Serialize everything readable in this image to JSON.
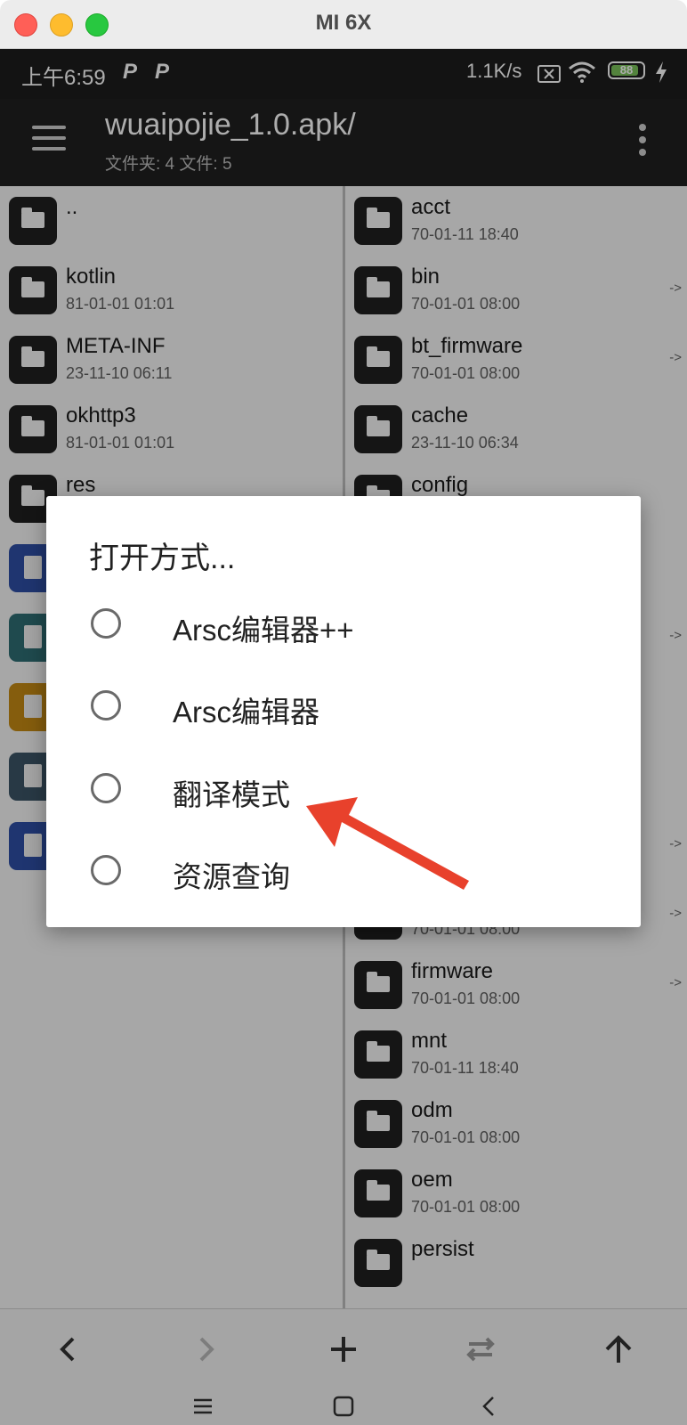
{
  "window": {
    "title": "MI 6X"
  },
  "status_bar": {
    "time": "上午6:59",
    "p_icons": [
      "P",
      "P"
    ],
    "net_speed": "1.1K/s",
    "battery": "88"
  },
  "app_bar": {
    "title": "wuaipojie_1.0.apk/",
    "subtitle": "文件夹: 4  文件: 5"
  },
  "left_pane": {
    "items": [
      {
        "name": "..",
        "date": ""
      },
      {
        "name": "kotlin",
        "date": "81-01-01 01:01"
      },
      {
        "name": "META-INF",
        "date": "23-11-10 06:11"
      },
      {
        "name": "okhttp3",
        "date": "81-01-01 01:01"
      },
      {
        "name": "res",
        "date": ""
      }
    ]
  },
  "right_pane": {
    "items": [
      {
        "name": "acct",
        "date": "70-01-11 18:40",
        "arrow": ""
      },
      {
        "name": "bin",
        "date": "70-01-01 08:00",
        "arrow": "->"
      },
      {
        "name": "bt_firmware",
        "date": "70-01-01 08:00",
        "arrow": "->"
      },
      {
        "name": "cache",
        "date": "23-11-10 06:34",
        "arrow": ""
      },
      {
        "name": "config",
        "date": "",
        "arrow": ""
      },
      {
        "name": "",
        "date": "",
        "arrow": "->"
      },
      {
        "name": "",
        "date": "",
        "arrow": "->"
      },
      {
        "name": "",
        "date": "70-01-01 08:00",
        "arrow": "->"
      },
      {
        "name": "firmware",
        "date": "70-01-01 08:00",
        "arrow": "->"
      },
      {
        "name": "mnt",
        "date": "70-01-11 18:40",
        "arrow": ""
      },
      {
        "name": "odm",
        "date": "70-01-01 08:00",
        "arrow": ""
      },
      {
        "name": "oem",
        "date": "70-01-01 08:00",
        "arrow": ""
      },
      {
        "name": "persist",
        "date": "",
        "arrow": ""
      }
    ]
  },
  "dialog": {
    "title": "打开方式...",
    "options": [
      {
        "label": "Arsc编辑器++"
      },
      {
        "label": "Arsc编辑器"
      },
      {
        "label": "翻译模式"
      },
      {
        "label": "资源查询"
      }
    ]
  },
  "toolbar": {
    "buttons": [
      "chevron-left-icon",
      "chevron-right-icon",
      "plus-icon",
      "swap-icon",
      "arrow-up-icon"
    ]
  },
  "colors": {
    "annotation_arrow": "#e8412c",
    "app_bar": "#202020",
    "status_bar": "#1c1c1c"
  }
}
